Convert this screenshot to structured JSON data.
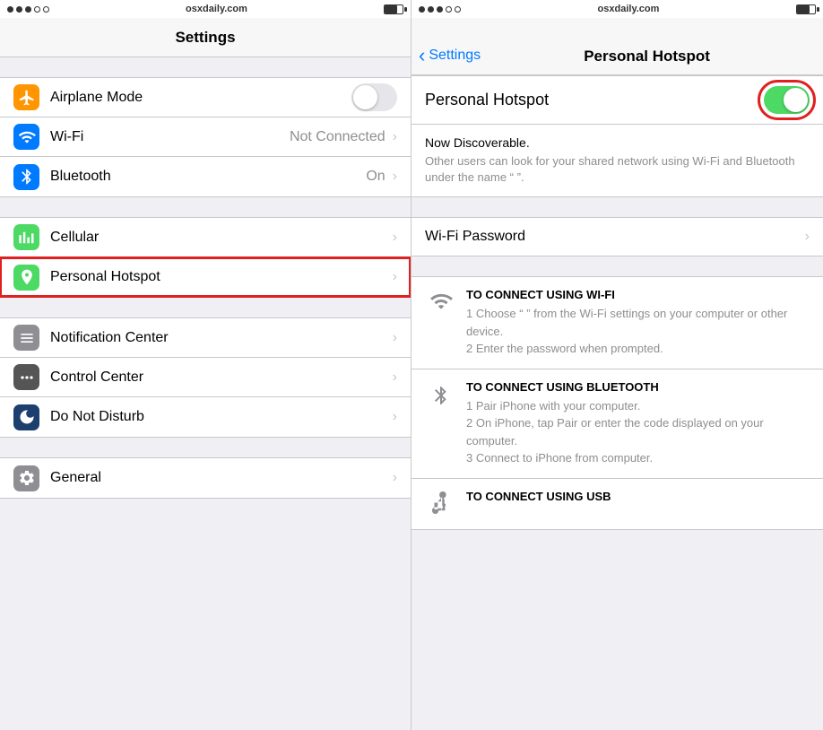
{
  "left": {
    "status": {
      "url": "osxdaily.com",
      "battery_level": 70
    },
    "nav_title": "Settings",
    "items": [
      {
        "id": "airplane",
        "label": "Airplane Mode",
        "value": "",
        "has_toggle": true,
        "toggle_on": false,
        "icon_color": "orange",
        "icon": "airplane"
      },
      {
        "id": "wifi",
        "label": "Wi-Fi",
        "value": "Not Connected",
        "has_chevron": true,
        "icon_color": "blue",
        "icon": "wifi"
      },
      {
        "id": "bluetooth",
        "label": "Bluetooth",
        "value": "On",
        "has_chevron": true,
        "icon_color": "blue2",
        "icon": "bluetooth"
      },
      {
        "id": "cellular",
        "label": "Cellular",
        "value": "",
        "has_chevron": true,
        "icon_color": "green-dark",
        "icon": "cellular"
      },
      {
        "id": "hotspot",
        "label": "Personal Hotspot",
        "value": "",
        "has_chevron": true,
        "icon_color": "green",
        "icon": "hotspot",
        "highlighted": true
      },
      {
        "id": "notification",
        "label": "Notification Center",
        "value": "",
        "has_chevron": true,
        "icon_color": "gray",
        "icon": "notification"
      },
      {
        "id": "control",
        "label": "Control Center",
        "value": "",
        "has_chevron": true,
        "icon_color": "dark-gray",
        "icon": "control"
      },
      {
        "id": "donotdisturb",
        "label": "Do Not Disturb",
        "value": "",
        "has_chevron": true,
        "icon_color": "navy",
        "icon": "moon"
      },
      {
        "id": "general",
        "label": "General",
        "value": "",
        "has_chevron": true,
        "icon_color": "gray2",
        "icon": "gear"
      }
    ]
  },
  "right": {
    "status": {
      "url": "osxdaily.com"
    },
    "back_label": "Settings",
    "nav_title": "Personal Hotspot",
    "hotspot_label": "Personal Hotspot",
    "discoverable_title": "Now Discoverable.",
    "discoverable_text": "Other users can look for your shared network using Wi-Fi and Bluetooth under the name “            ”.",
    "wifi_password_label": "Wi-Fi Password",
    "connect_sections": [
      {
        "id": "wifi",
        "title": "TO CONNECT USING WI-FI",
        "steps": [
          "1 Choose “            ” from the Wi-Fi settings on your computer or other device.",
          "2 Enter the password when prompted."
        ]
      },
      {
        "id": "bluetooth",
        "title": "TO CONNECT USING BLUETOOTH",
        "steps": [
          "1 Pair iPhone with your computer.",
          "2 On iPhone, tap Pair or enter the code displayed on your computer.",
          "3 Connect to iPhone from computer."
        ]
      },
      {
        "id": "usb",
        "title": "TO CONNECT USING USB",
        "steps": []
      }
    ]
  }
}
